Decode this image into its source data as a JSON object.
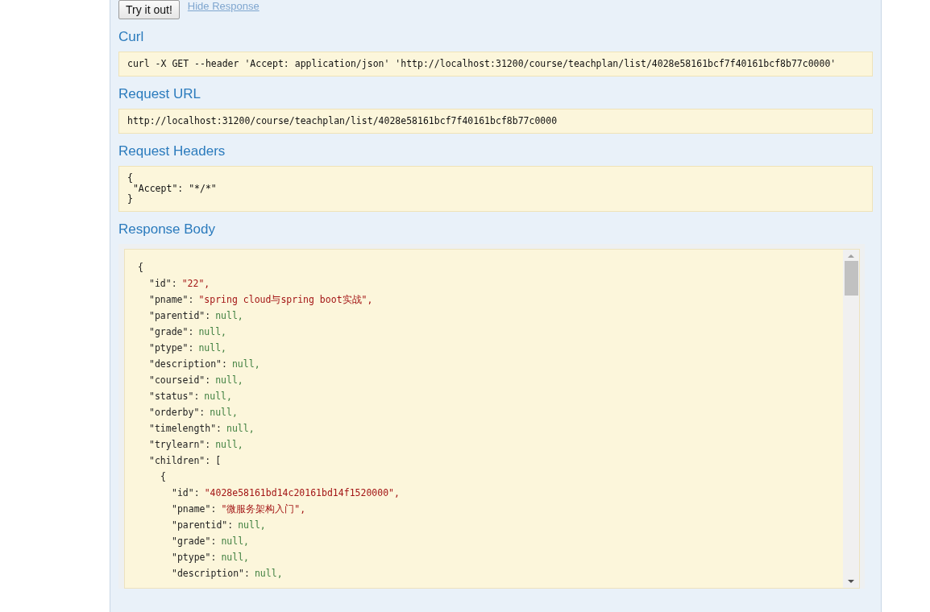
{
  "actions": {
    "try_button": "Try it out!",
    "hide_link": "Hide Response"
  },
  "sections": [
    {
      "title": "Curl",
      "code": [
        "curl -X GET --header 'Accept: application/json' 'http://localhost:31200/course/teachplan/list/4028e58161bcf7f40161bcf8b77c0000'"
      ]
    },
    {
      "title": "Request URL",
      "code": [
        "http://localhost:31200/course/teachplan/list/4028e58161bcf7f40161bcf8b77c0000"
      ]
    },
    {
      "title": "Request Headers",
      "code": [
        "{",
        " \"Accept\": \"*/*\"",
        "}"
      ]
    }
  ],
  "response_body": {
    "title": "Response Body",
    "open": "{",
    "fields": [
      {
        "key": "\"id\":",
        "value": "\"22\",",
        "kind": "string"
      },
      {
        "key": "\"pname\":",
        "value": "\"spring cloud与spring boot实战\",",
        "kind": "string"
      },
      {
        "key": "\"parentid\":",
        "value": "null,",
        "kind": "null"
      },
      {
        "key": "\"grade\":",
        "value": "null,",
        "kind": "null"
      },
      {
        "key": "\"ptype\":",
        "value": "null,",
        "kind": "null"
      },
      {
        "key": "\"description\":",
        "value": "null,",
        "kind": "null"
      },
      {
        "key": "\"courseid\":",
        "value": "null,",
        "kind": "null"
      },
      {
        "key": "\"status\":",
        "value": "null,",
        "kind": "null"
      },
      {
        "key": "\"orderby\":",
        "value": "null,",
        "kind": "null"
      },
      {
        "key": "\"timelength\":",
        "value": "null,",
        "kind": "null"
      },
      {
        "key": "\"trylearn\":",
        "value": "null,",
        "kind": "null"
      },
      {
        "key": "\"children\":",
        "value": "[",
        "kind": "open",
        "items": [
          {
            "open": "{",
            "fields": [
              {
                "key": "\"id\":",
                "value": "\"4028e58161bd14c20161bd14f1520000\",",
                "kind": "string"
              },
              {
                "key": "\"pname\":",
                "value": "\"微服务架构入门\",",
                "kind": "string"
              },
              {
                "key": "\"parentid\":",
                "value": "null,",
                "kind": "null"
              },
              {
                "key": "\"grade\":",
                "value": "null,",
                "kind": "null"
              },
              {
                "key": "\"ptype\":",
                "value": "null,",
                "kind": "null"
              },
              {
                "key": "\"description\":",
                "value": "null,",
                "kind": "null"
              }
            ]
          }
        ]
      }
    ]
  }
}
